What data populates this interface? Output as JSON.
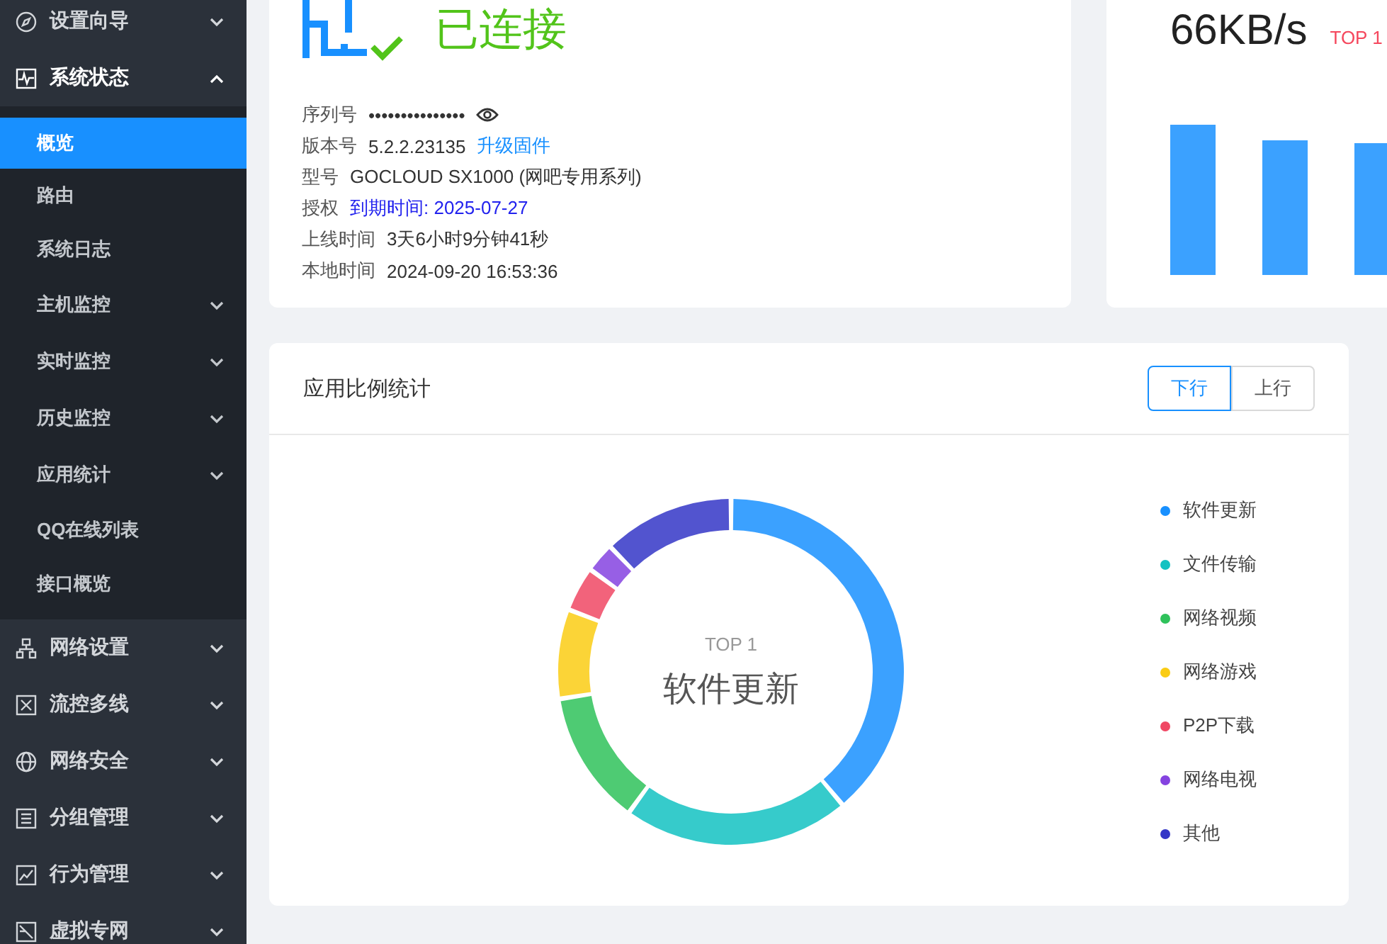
{
  "sidebar": {
    "items": [
      {
        "label": "设置向导",
        "expanded": false,
        "kind": "group",
        "selected": false
      },
      {
        "label": "系统状态",
        "expanded": true,
        "kind": "group",
        "selected": false,
        "children": [
          {
            "label": "概览",
            "selected": true,
            "kind": "leaf"
          },
          {
            "label": "路由",
            "selected": false,
            "kind": "leaf"
          },
          {
            "label": "系统日志",
            "selected": false,
            "kind": "leaf"
          },
          {
            "label": "主机监控",
            "selected": false,
            "kind": "group"
          },
          {
            "label": "实时监控",
            "selected": false,
            "kind": "group"
          },
          {
            "label": "历史监控",
            "selected": false,
            "kind": "group"
          },
          {
            "label": "应用统计",
            "selected": false,
            "kind": "group"
          },
          {
            "label": "QQ在线列表",
            "selected": false,
            "kind": "leaf"
          },
          {
            "label": "接口概览",
            "selected": false,
            "kind": "leaf"
          }
        ]
      },
      {
        "label": "网络设置",
        "expanded": false,
        "kind": "group",
        "selected": false
      },
      {
        "label": "流控多线",
        "expanded": false,
        "kind": "group",
        "selected": false
      },
      {
        "label": "网络安全",
        "expanded": false,
        "kind": "group",
        "selected": false
      },
      {
        "label": "分组管理",
        "expanded": false,
        "kind": "group",
        "selected": false
      },
      {
        "label": "行为管理",
        "expanded": false,
        "kind": "group",
        "selected": false
      },
      {
        "label": "虚拟专网",
        "expanded": false,
        "kind": "group",
        "selected": false
      }
    ]
  },
  "device_card": {
    "status": "已连接",
    "info": [
      {
        "label": "序列号",
        "value": "•••••••••••••••",
        "kind": "secret"
      },
      {
        "label": "版本号",
        "value": "5.2.2.23135",
        "link": "升级固件",
        "kind": "link"
      },
      {
        "label": "型号",
        "value": "GOCLOUD SX1000 (网吧专用系列)",
        "kind": "plain"
      },
      {
        "label": "授权",
        "value": "到期时间: 2025-07-27",
        "kind": "license"
      },
      {
        "label": "上线时间",
        "value": "3天6小时9分钟41秒",
        "kind": "plain"
      },
      {
        "label": "本地时间",
        "value": "2024-09-20 16:53:36",
        "kind": "plain"
      }
    ]
  },
  "traffic_card": {
    "rate": "66KB/s",
    "badge": "TOP 1"
  },
  "app_stats": {
    "title": "应用比例统计",
    "toggle": [
      {
        "label": "下行",
        "selected": true
      },
      {
        "label": "上行",
        "selected": false
      }
    ],
    "center_caption": "TOP 1",
    "center_label": "软件更新",
    "legend": [
      {
        "label": "软件更新",
        "color": "#1890ff"
      },
      {
        "label": "文件传输",
        "color": "#13c2c2"
      },
      {
        "label": "网络视频",
        "color": "#2fc25b"
      },
      {
        "label": "网络游戏",
        "color": "#facc14"
      },
      {
        "label": "P2P下载",
        "color": "#f04864"
      },
      {
        "label": "网络电视",
        "color": "#8543e0"
      },
      {
        "label": "其他",
        "color": "#3436c7"
      }
    ]
  }
}
